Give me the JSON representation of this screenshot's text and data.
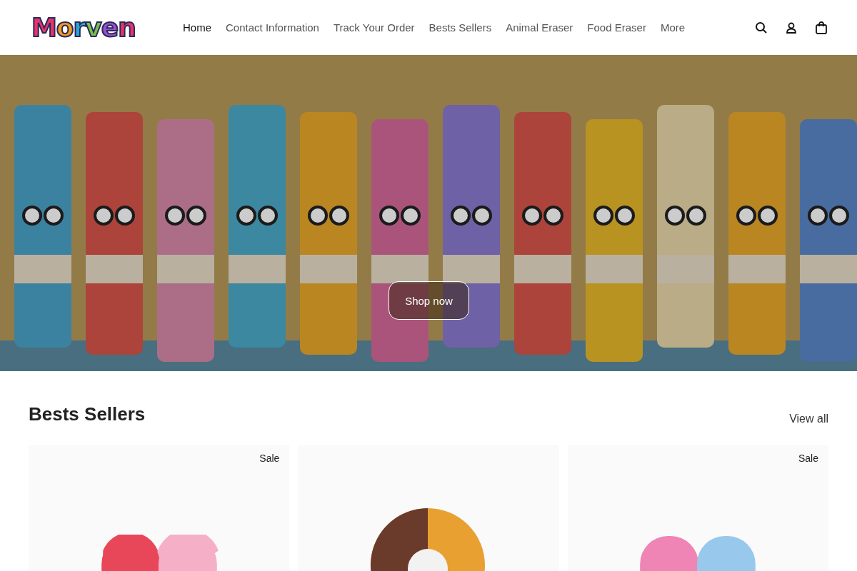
{
  "header": {
    "logo": "Morven",
    "nav": [
      {
        "label": "Home",
        "selected": true
      },
      {
        "label": "Contact Information",
        "selected": false
      },
      {
        "label": "Track Your Order",
        "selected": false
      },
      {
        "label": "Bests Sellers",
        "selected": false
      },
      {
        "label": "Animal Eraser",
        "selected": false
      },
      {
        "label": "Food Eraser",
        "selected": false
      },
      {
        "label": "More",
        "selected": false
      }
    ]
  },
  "hero": {
    "button": "Shop now"
  },
  "section": {
    "title": "Bests Sellers",
    "link": "View all",
    "products": [
      {
        "kind": "heart",
        "badge": "Sale"
      },
      {
        "kind": "donut"
      },
      {
        "kind": "heart-blue",
        "badge": "Sale"
      }
    ]
  }
}
